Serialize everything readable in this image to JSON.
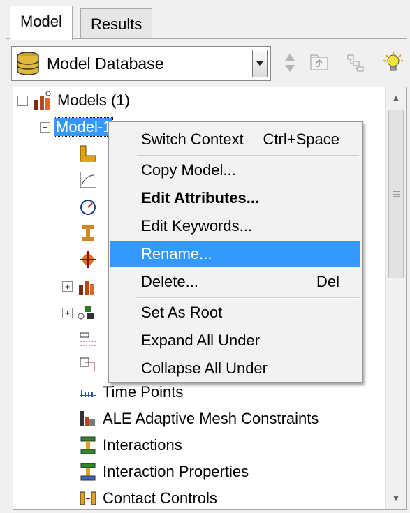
{
  "tabs": [
    {
      "label": "Model"
    },
    {
      "label": "Results"
    }
  ],
  "toolbar": {
    "combo_value": "Model Database"
  },
  "tree": {
    "root": "Models (1)",
    "model": "Model-1",
    "items": [
      {
        "label": "Time Points",
        "icon": "time-points-icon"
      },
      {
        "label": "ALE Adaptive Mesh Constraints",
        "icon": "ale-mesh-icon"
      },
      {
        "label": "Interactions",
        "icon": "interactions-icon"
      },
      {
        "label": "Interaction Properties",
        "icon": "interaction-properties-icon"
      },
      {
        "label": "Contact Controls",
        "icon": "contact-controls-icon"
      }
    ]
  },
  "context_menu": {
    "items": [
      {
        "label": "Switch Context",
        "shortcut": "Ctrl+Space"
      },
      {
        "label": "Copy Model..."
      },
      {
        "label": "Edit Attributes..."
      },
      {
        "label": "Edit Keywords..."
      },
      {
        "label": "Rename..."
      },
      {
        "label": "Delete...",
        "shortcut": "Del"
      },
      {
        "label": "Set As Root"
      },
      {
        "label": "Expand All Under"
      },
      {
        "label": "Collapse All Under"
      }
    ],
    "highlighted": "Rename..."
  },
  "colors": {
    "selection": "#3399ff",
    "background": "#f0f0f0"
  }
}
